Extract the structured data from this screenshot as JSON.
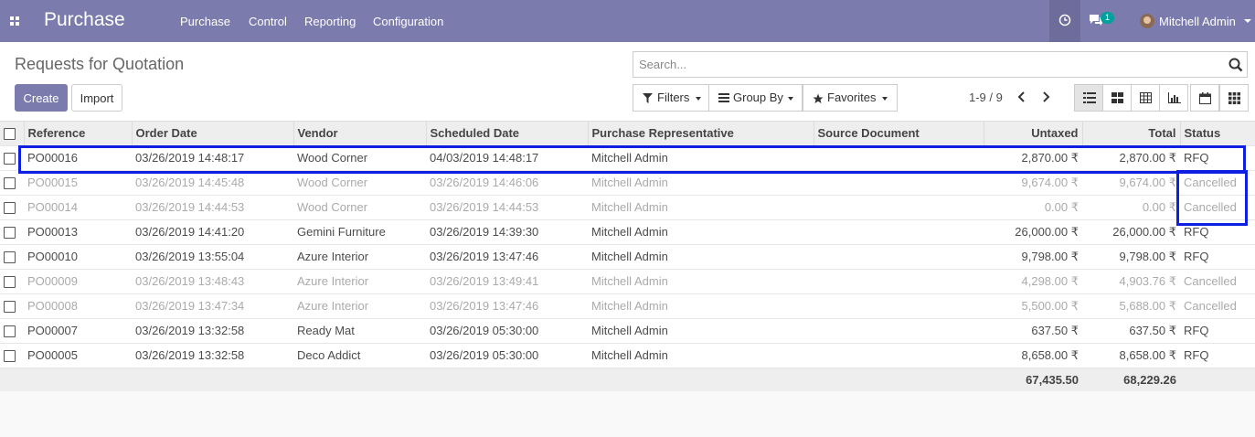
{
  "navbar": {
    "brand": "Purchase",
    "menu": [
      "Purchase",
      "Control",
      "Reporting",
      "Configuration"
    ],
    "chat_count": "1",
    "user_name": "Mitchell Admin"
  },
  "control_panel": {
    "title": "Requests for Quotation",
    "create_label": "Create",
    "import_label": "Import",
    "search_placeholder": "Search...",
    "filters_label": "Filters",
    "group_by_label": "Group By",
    "favorites_label": "Favorites",
    "pager": "1-9 / 9"
  },
  "table": {
    "columns": [
      "Reference",
      "Order Date",
      "Vendor",
      "Scheduled Date",
      "Purchase Representative",
      "Source Document",
      "Untaxed",
      "Total",
      "Status"
    ],
    "rows": [
      [
        "PO00016",
        "03/26/2019 14:48:17",
        "Wood Corner",
        "04/03/2019 14:48:17",
        "Mitchell Admin",
        "",
        "2,870.00 ₹",
        "2,870.00 ₹",
        "RFQ"
      ],
      [
        "PO00015",
        "03/26/2019 14:45:48",
        "Wood Corner",
        "03/26/2019 14:46:06",
        "Mitchell Admin",
        "",
        "9,674.00 ₹",
        "9,674.00 ₹",
        "Cancelled"
      ],
      [
        "PO00014",
        "03/26/2019 14:44:53",
        "Wood Corner",
        "03/26/2019 14:44:53",
        "Mitchell Admin",
        "",
        "0.00 ₹",
        "0.00 ₹",
        "Cancelled"
      ],
      [
        "PO00013",
        "03/26/2019 14:41:20",
        "Gemini Furniture",
        "03/26/2019 14:39:30",
        "Mitchell Admin",
        "",
        "26,000.00 ₹",
        "26,000.00 ₹",
        "RFQ"
      ],
      [
        "PO00010",
        "03/26/2019 13:55:04",
        "Azure Interior",
        "03/26/2019 13:47:46",
        "Mitchell Admin",
        "",
        "9,798.00 ₹",
        "9,798.00 ₹",
        "RFQ"
      ],
      [
        "PO00009",
        "03/26/2019 13:48:43",
        "Azure Interior",
        "03/26/2019 13:49:41",
        "Mitchell Admin",
        "",
        "4,298.00 ₹",
        "4,903.76 ₹",
        "Cancelled"
      ],
      [
        "PO00008",
        "03/26/2019 13:47:34",
        "Azure Interior",
        "03/26/2019 13:47:46",
        "Mitchell Admin",
        "",
        "5,500.00 ₹",
        "5,688.00 ₹",
        "Cancelled"
      ],
      [
        "PO00007",
        "03/26/2019 13:32:58",
        "Ready Mat",
        "03/26/2019 05:30:00",
        "Mitchell Admin",
        "",
        "637.50 ₹",
        "637.50 ₹",
        "RFQ"
      ],
      [
        "PO00005",
        "03/26/2019 13:32:58",
        "Deco Addict",
        "03/26/2019 05:30:00",
        "Mitchell Admin",
        "",
        "8,658.00 ₹",
        "8,658.00 ₹",
        "RFQ"
      ]
    ],
    "totals": {
      "untaxed": "67,435.50",
      "total": "68,229.26"
    }
  },
  "colors": {
    "brand": "#7c7bad",
    "highlight": "#0d1fe0",
    "badge": "#00a09d"
  }
}
